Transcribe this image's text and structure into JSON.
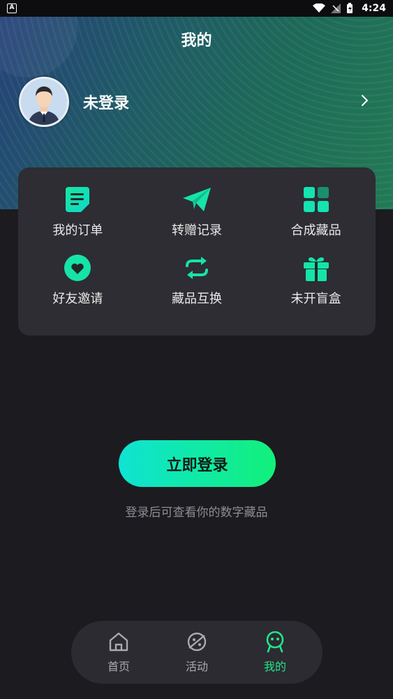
{
  "status_bar": {
    "time": "4:24",
    "left_icon": "A"
  },
  "header": {
    "title": "我的"
  },
  "profile": {
    "name": "未登录"
  },
  "menu": {
    "items": [
      {
        "label": "我的订单",
        "icon": "order-list-icon"
      },
      {
        "label": "转赠记录",
        "icon": "paper-plane-icon"
      },
      {
        "label": "合成藏品",
        "icon": "grid-tiles-icon"
      },
      {
        "label": "好友邀请",
        "icon": "heart-circle-icon"
      },
      {
        "label": "藏品互换",
        "icon": "swap-arrows-icon"
      },
      {
        "label": "未开盲盒",
        "icon": "gift-box-icon"
      }
    ]
  },
  "login": {
    "button_label": "立即登录",
    "hint": "登录后可查看你的数字藏品"
  },
  "nav": {
    "items": [
      {
        "label": "首页",
        "icon": "home-icon",
        "active": false
      },
      {
        "label": "活动",
        "icon": "planet-icon",
        "active": false
      },
      {
        "label": "我的",
        "icon": "smiley-mine-icon",
        "active": true
      }
    ]
  },
  "colors": {
    "accent": "#25e38a",
    "accent_cyan": "#0fe3d3",
    "card_bg": "#2d2d33",
    "page_bg": "#1b1b20"
  }
}
